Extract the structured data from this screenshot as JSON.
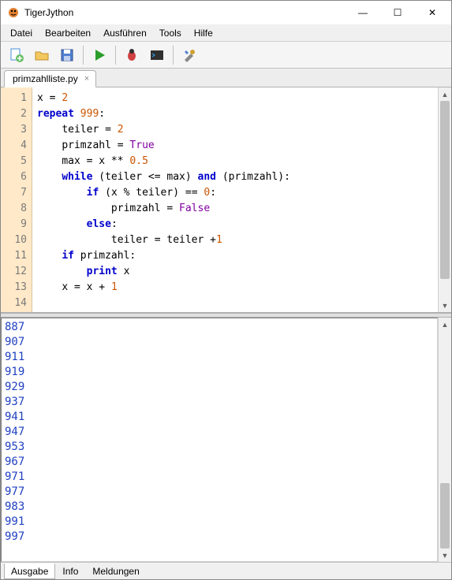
{
  "window": {
    "title": "TigerJython",
    "controls": {
      "min": "—",
      "max": "☐",
      "close": "✕"
    }
  },
  "menu": [
    "Datei",
    "Bearbeiten",
    "Ausführen",
    "Tools",
    "Hilfe"
  ],
  "toolbar_icons": [
    "new-file",
    "open-file",
    "save-file",
    "run",
    "debug",
    "console",
    "preferences"
  ],
  "tabs": [
    {
      "label": "primzahlliste.py",
      "close": "×"
    }
  ],
  "code": {
    "lines": [
      1,
      2,
      3,
      4,
      5,
      6,
      7,
      8,
      9,
      10,
      11,
      12,
      13,
      14
    ],
    "tokens": [
      [
        [
          "name",
          "x"
        ],
        [
          "op",
          " = "
        ],
        [
          "num",
          "2"
        ]
      ],
      [
        [
          "kw",
          "repeat"
        ],
        [
          "op",
          " "
        ],
        [
          "num",
          "999"
        ],
        [
          "op",
          ":"
        ]
      ],
      [
        [
          "op",
          "    "
        ],
        [
          "name",
          "teiler"
        ],
        [
          "op",
          " = "
        ],
        [
          "num",
          "2"
        ]
      ],
      [
        [
          "op",
          "    "
        ],
        [
          "name",
          "primzahl"
        ],
        [
          "op",
          " = "
        ],
        [
          "const",
          "True"
        ]
      ],
      [
        [
          "op",
          "    "
        ],
        [
          "name",
          "max"
        ],
        [
          "op",
          " = "
        ],
        [
          "name",
          "x"
        ],
        [
          "op",
          " ** "
        ],
        [
          "num",
          "0.5"
        ]
      ],
      [
        [
          "op",
          "    "
        ],
        [
          "kw",
          "while"
        ],
        [
          "op",
          " ("
        ],
        [
          "name",
          "teiler"
        ],
        [
          "op",
          " <= "
        ],
        [
          "name",
          "max"
        ],
        [
          "op",
          ") "
        ],
        [
          "kw",
          "and"
        ],
        [
          "op",
          " ("
        ],
        [
          "name",
          "primzahl"
        ],
        [
          "op",
          "):"
        ]
      ],
      [
        [
          "op",
          "        "
        ],
        [
          "kw",
          "if"
        ],
        [
          "op",
          " ("
        ],
        [
          "name",
          "x"
        ],
        [
          "op",
          " % "
        ],
        [
          "name",
          "teiler"
        ],
        [
          "op",
          ") == "
        ],
        [
          "num",
          "0"
        ],
        [
          "op",
          ":"
        ]
      ],
      [
        [
          "op",
          "            "
        ],
        [
          "name",
          "primzahl"
        ],
        [
          "op",
          " = "
        ],
        [
          "const",
          "False"
        ]
      ],
      [
        [
          "op",
          "        "
        ],
        [
          "kw",
          "else"
        ],
        [
          "op",
          ":"
        ]
      ],
      [
        [
          "op",
          "            "
        ],
        [
          "name",
          "teiler"
        ],
        [
          "op",
          " = "
        ],
        [
          "name",
          "teiler"
        ],
        [
          "op",
          " +"
        ],
        [
          "num",
          "1"
        ]
      ],
      [
        [
          "op",
          "    "
        ],
        [
          "kw",
          "if"
        ],
        [
          "op",
          " "
        ],
        [
          "name",
          "primzahl"
        ],
        [
          "op",
          ":"
        ]
      ],
      [
        [
          "op",
          "        "
        ],
        [
          "kw",
          "print"
        ],
        [
          "op",
          " "
        ],
        [
          "name",
          "x"
        ]
      ],
      [
        [
          "op",
          "    "
        ],
        [
          "name",
          "x"
        ],
        [
          "op",
          " = "
        ],
        [
          "name",
          "x"
        ],
        [
          "op",
          " + "
        ],
        [
          "num",
          "1"
        ]
      ],
      []
    ]
  },
  "output": [
    "887",
    "907",
    "911",
    "919",
    "929",
    "937",
    "941",
    "947",
    "953",
    "967",
    "971",
    "977",
    "983",
    "991",
    "997"
  ],
  "bottom_tabs": [
    "Ausgabe",
    "Info",
    "Meldungen"
  ],
  "scroll": {
    "up": "▲",
    "down": "▼"
  }
}
